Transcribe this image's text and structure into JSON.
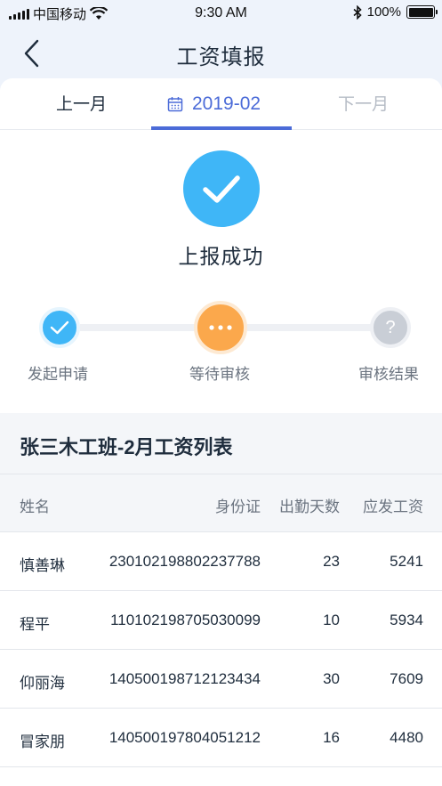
{
  "status_bar": {
    "carrier": "中国移动",
    "time": "9:30 AM",
    "battery": "100%"
  },
  "nav": {
    "title": "工资填报"
  },
  "month_tabs": {
    "prev": "上一月",
    "current": "2019-02",
    "next": "下一月"
  },
  "result": {
    "text": "上报成功"
  },
  "steps": [
    {
      "label": "发起申请",
      "state": "done"
    },
    {
      "label": "等待审核",
      "state": "pending",
      "glyph": "···"
    },
    {
      "label": "审核结果",
      "state": "unknown",
      "glyph": "?"
    }
  ],
  "list": {
    "title": "张三木工班-2月工资列表",
    "columns": {
      "name": "姓名",
      "id": "身份证",
      "days": "出勤天数",
      "pay": "应发工资"
    },
    "rows": [
      {
        "name": "慎善琳",
        "id": "230102198802237788",
        "days": "23",
        "pay": "5241"
      },
      {
        "name": "程平",
        "id": "110102198705030099",
        "days": "10",
        "pay": "5934"
      },
      {
        "name": "仰丽海",
        "id": "140500198712123434",
        "days": "30",
        "pay": "7609"
      },
      {
        "name": "冒家朋",
        "id": "140500197804051212",
        "days": "16",
        "pay": "4480"
      }
    ]
  },
  "colors": {
    "accent": "#4b6bd8",
    "success": "#3fb6f7",
    "pending": "#fba84c",
    "inactive": "#c9ced6"
  }
}
